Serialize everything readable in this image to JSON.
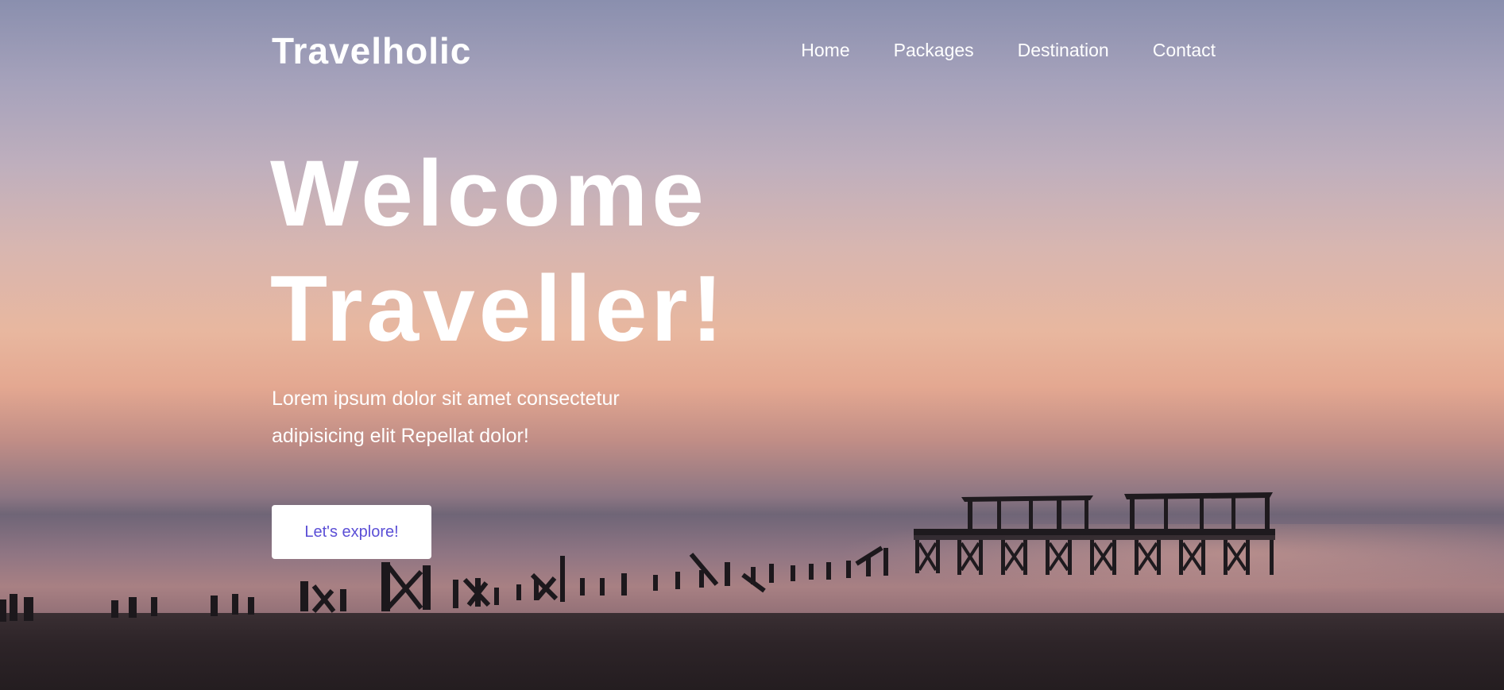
{
  "header": {
    "brand": "Travelholic",
    "nav": [
      {
        "label": "Home"
      },
      {
        "label": "Packages"
      },
      {
        "label": "Destination"
      },
      {
        "label": "Contact"
      }
    ]
  },
  "hero": {
    "headline_line1": "Welcome",
    "headline_line2": "Traveller!",
    "subtitle_line1": "Lorem ipsum dolor sit amet consectetur",
    "subtitle_line2": "adipisicing elit Repellat dolor!",
    "cta_label": "Let's explore!"
  },
  "colors": {
    "text": "#ffffff",
    "cta_text": "#5b4fd6",
    "cta_background": "#ffffff"
  }
}
